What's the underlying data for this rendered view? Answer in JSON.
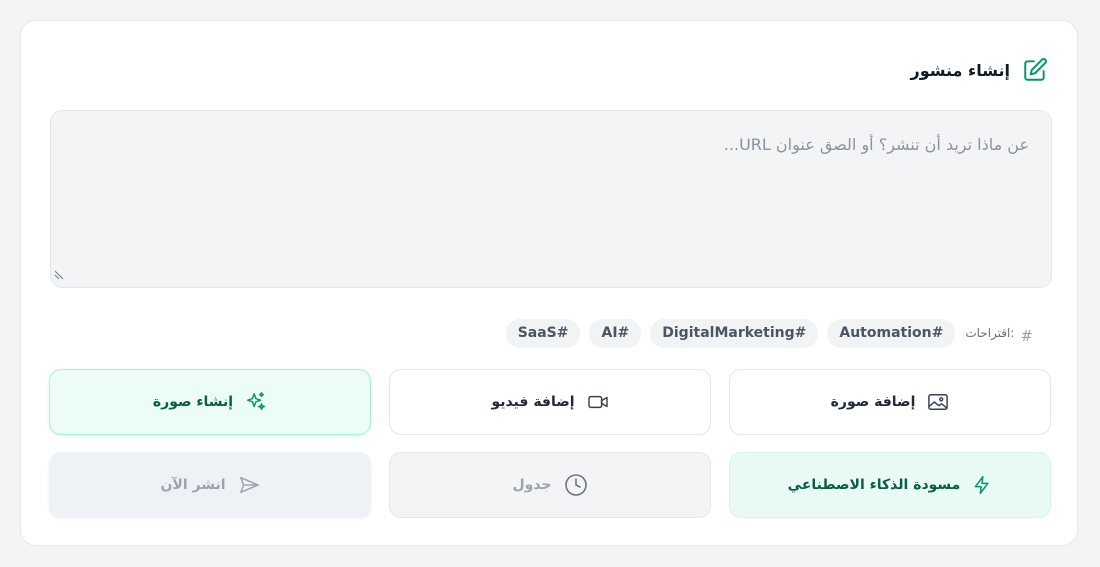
{
  "header": {
    "title": "إنشاء منشور",
    "icon": "edit-icon"
  },
  "editor": {
    "placeholder": "عن ماذا تريد أن تنشر؟ أو الصق عنوان URL..."
  },
  "suggestions": {
    "label": "اقتراحات:",
    "chips": [
      "Automation#",
      "DigitalMarketing#",
      "AI#",
      "SaaS#"
    ]
  },
  "actions": {
    "add_image": "إضافة صورة",
    "add_video": "إضافة فيديو",
    "generate_image": "إنشاء صورة",
    "ai_draft": "مسودة الذكاء الاصطناعي",
    "schedule": "جدول",
    "publish_now": "انشر الآن"
  },
  "colors": {
    "accent": "#059669",
    "accent_bg": "#ecfdf5",
    "border": "#e5e7eb",
    "disabled_text": "#9ca3af"
  }
}
